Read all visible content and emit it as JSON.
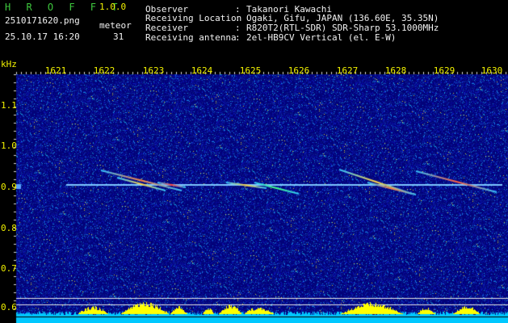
{
  "header": {
    "app_title": "H R O F F T",
    "version": "1.0.0",
    "filename": "2510171620.png",
    "timestamp": "25.10.17 16:20",
    "meteor_label": "meteor",
    "meteor_count": "31",
    "info": [
      {
        "key": "Observer",
        "sep": ":",
        "value": "Takanori Kawachi"
      },
      {
        "key": "Receiving Location",
        "sep": ":",
        "value": "Ogaki, Gifu, JAPAN (136.60E, 35.35N)"
      },
      {
        "key": "Receiver",
        "sep": ":",
        "value": "R820T2(RTL-SDR) SDR-Sharp 53.1000MHz"
      },
      {
        "key": "Receiving antenna",
        "sep": ":",
        "value": "2el-HB9CV Vertical (el. E-W)"
      }
    ]
  },
  "spectrogram": {
    "unit_label": "kHz",
    "time_labels": [
      "1621",
      "1622",
      "1623",
      "1624",
      "1625",
      "1626",
      "1627",
      "1628",
      "1629",
      "1630"
    ],
    "freq_labels": [
      "1.1",
      "1.0",
      "0.9",
      "0.8",
      "0.7",
      "0.6"
    ],
    "colors": {
      "background": "#02027a",
      "carrier": "#7ec8ff",
      "meteor": "#ffd040",
      "level_bars": "#ffff00",
      "level_base": "#00c8ff"
    }
  }
}
